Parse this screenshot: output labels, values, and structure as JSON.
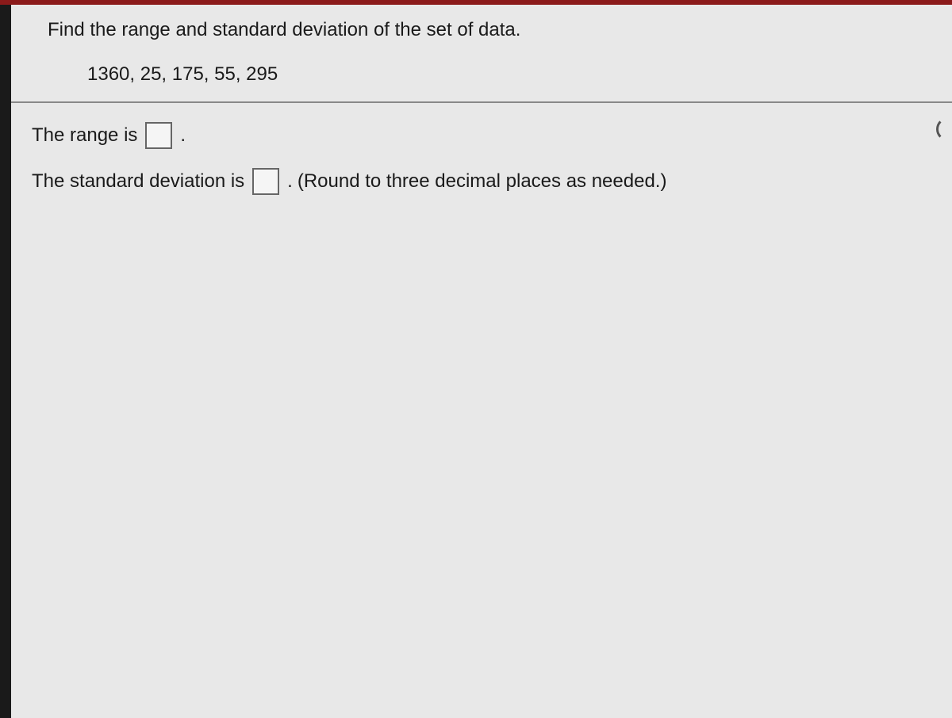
{
  "question": {
    "prompt": "Find the range and standard deviation of the set of data.",
    "data_values": "1360, 25, 175, 55, 295"
  },
  "answers": {
    "range_prefix": "The range is",
    "range_suffix": ".",
    "stddev_prefix": "The standard deviation is",
    "stddev_suffix": ".",
    "hint": "(Round to three decimal places as needed.)"
  }
}
